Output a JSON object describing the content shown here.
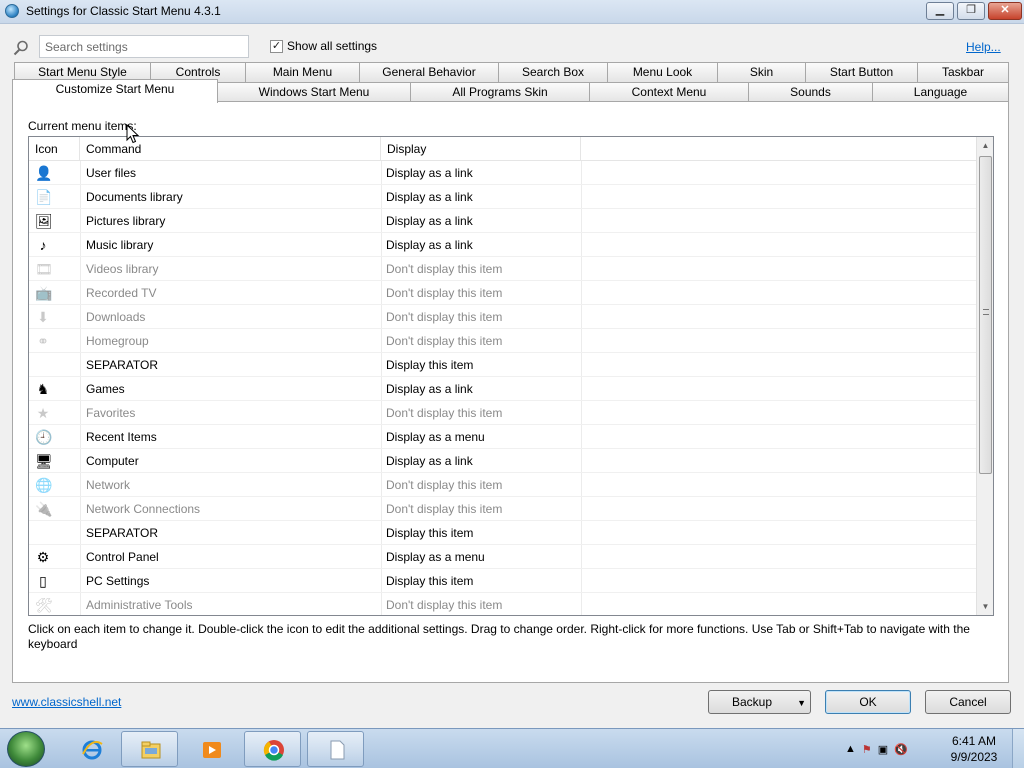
{
  "window": {
    "title": "Settings for Classic Start Menu 4.3.1"
  },
  "search": {
    "placeholder": "Search settings"
  },
  "show_all": {
    "label": "Show all settings",
    "checked": true
  },
  "help_link": "Help...",
  "tabs_row1": [
    "Start Menu Style",
    "Controls",
    "Main Menu",
    "General Behavior",
    "Search Box",
    "Menu Look",
    "Skin",
    "Start Button",
    "Taskbar"
  ],
  "tabs_row2": [
    "Customize Start Menu",
    "Windows Start Menu",
    "All Programs Skin",
    "Context Menu",
    "Sounds",
    "Language"
  ],
  "active_tab": "Customize Start Menu",
  "panel": {
    "current_label": "Current menu items:",
    "columns": {
      "icon": "Icon",
      "command": "Command",
      "display": "Display"
    },
    "items": [
      {
        "icon": "user-files-icon",
        "command": "User files",
        "display": "Display as a link",
        "enabled": true
      },
      {
        "icon": "documents-icon",
        "command": "Documents library",
        "display": "Display as a link",
        "enabled": true
      },
      {
        "icon": "pictures-icon",
        "command": "Pictures library",
        "display": "Display as a link",
        "enabled": true
      },
      {
        "icon": "music-icon",
        "command": "Music library",
        "display": "Display as a link",
        "enabled": true
      },
      {
        "icon": "videos-icon",
        "command": "Videos library",
        "display": "Don't display this item",
        "enabled": false
      },
      {
        "icon": "recorded-tv-icon",
        "command": "Recorded TV",
        "display": "Don't display this item",
        "enabled": false
      },
      {
        "icon": "downloads-icon",
        "command": "Downloads",
        "display": "Don't display this item",
        "enabled": false
      },
      {
        "icon": "homegroup-icon",
        "command": "Homegroup",
        "display": "Don't display this item",
        "enabled": false
      },
      {
        "icon": "",
        "command": "SEPARATOR",
        "display": "Display this item",
        "enabled": true
      },
      {
        "icon": "games-icon",
        "command": "Games",
        "display": "Display as a link",
        "enabled": true
      },
      {
        "icon": "favorites-icon",
        "command": "Favorites",
        "display": "Don't display this item",
        "enabled": false
      },
      {
        "icon": "recent-items-icon",
        "command": "Recent Items",
        "display": "Display as a menu",
        "enabled": true
      },
      {
        "icon": "computer-icon",
        "command": "Computer",
        "display": "Display as a link",
        "enabled": true
      },
      {
        "icon": "network-icon",
        "command": "Network",
        "display": "Don't display this item",
        "enabled": false
      },
      {
        "icon": "network-connections-icon",
        "command": "Network Connections",
        "display": "Don't display this item",
        "enabled": false
      },
      {
        "icon": "",
        "command": "SEPARATOR",
        "display": "Display this item",
        "enabled": true
      },
      {
        "icon": "control-panel-icon",
        "command": "Control Panel",
        "display": "Display as a menu",
        "enabled": true
      },
      {
        "icon": "pc-settings-icon",
        "command": "PC Settings",
        "display": "Display this item",
        "enabled": true
      },
      {
        "icon": "administrative-tools-icon",
        "command": "Administrative Tools",
        "display": "Don't display this item",
        "enabled": false
      }
    ],
    "hint": "Click on each item to change it. Double-click the icon to edit the additional settings. Drag to change order. Right-click for more functions. Use Tab or Shift+Tab to navigate with the keyboard"
  },
  "footer": {
    "site_link": "www.classicshell.net",
    "backup_label": "Backup",
    "ok_label": "OK",
    "cancel_label": "Cancel"
  },
  "taskbar": {
    "apps": [
      "internet-explorer-icon",
      "file-explorer-icon",
      "media-player-icon",
      "chrome-icon",
      "document-icon"
    ],
    "time": "6:41 AM",
    "date": "9/9/2023"
  },
  "colors": {
    "link": "#0066cc",
    "dim_text": "#8a8a8a",
    "taskbar": "#b9d0e8"
  }
}
